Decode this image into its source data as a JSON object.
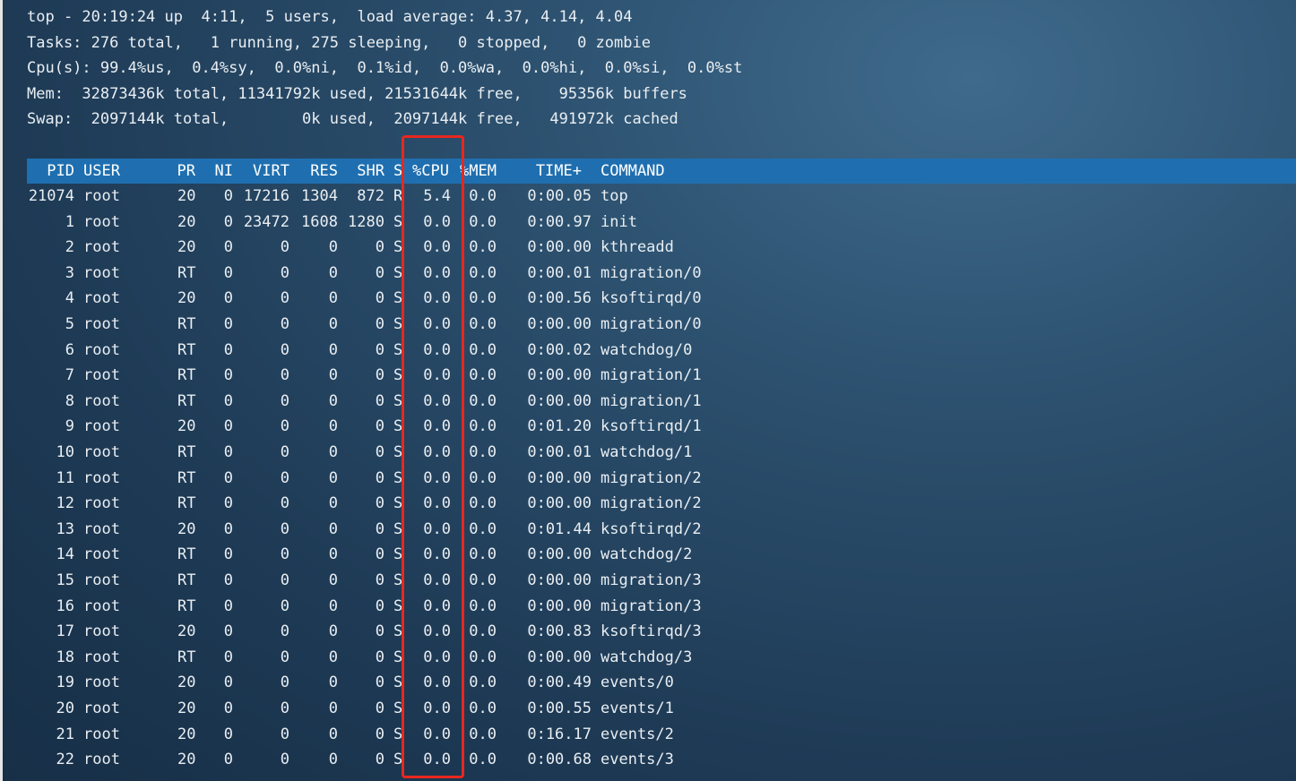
{
  "summary": {
    "line1": "top - 20:19:24 up  4:11,  5 users,  load average: 4.37, 4.14, 4.04",
    "line2": "Tasks: 276 total,   1 running, 275 sleeping,   0 stopped,   0 zombie",
    "line3": "Cpu(s): 99.4%us,  0.4%sy,  0.0%ni,  0.1%id,  0.0%wa,  0.0%hi,  0.0%si,  0.0%st",
    "line4": "Mem:  32873436k total, 11341792k used, 21531644k free,    95356k buffers",
    "line5": "Swap:  2097144k total,        0k used,  2097144k free,   491972k cached"
  },
  "columns": [
    "PID",
    "USER",
    "PR",
    "NI",
    "VIRT",
    "RES",
    "SHR",
    "S",
    "%CPU",
    "%MEM",
    "TIME+",
    "COMMAND"
  ],
  "processes": [
    {
      "pid": "21074",
      "user": "root",
      "pr": "20",
      "ni": "0",
      "virt": "17216",
      "res": "1304",
      "shr": "872",
      "s": "R",
      "cpu": "5.4",
      "mem": "0.0",
      "time": "0:00.05",
      "cmd": "top"
    },
    {
      "pid": "1",
      "user": "root",
      "pr": "20",
      "ni": "0",
      "virt": "23472",
      "res": "1608",
      "shr": "1280",
      "s": "S",
      "cpu": "0.0",
      "mem": "0.0",
      "time": "0:00.97",
      "cmd": "init"
    },
    {
      "pid": "2",
      "user": "root",
      "pr": "20",
      "ni": "0",
      "virt": "0",
      "res": "0",
      "shr": "0",
      "s": "S",
      "cpu": "0.0",
      "mem": "0.0",
      "time": "0:00.00",
      "cmd": "kthreadd"
    },
    {
      "pid": "3",
      "user": "root",
      "pr": "RT",
      "ni": "0",
      "virt": "0",
      "res": "0",
      "shr": "0",
      "s": "S",
      "cpu": "0.0",
      "mem": "0.0",
      "time": "0:00.01",
      "cmd": "migration/0"
    },
    {
      "pid": "4",
      "user": "root",
      "pr": "20",
      "ni": "0",
      "virt": "0",
      "res": "0",
      "shr": "0",
      "s": "S",
      "cpu": "0.0",
      "mem": "0.0",
      "time": "0:00.56",
      "cmd": "ksoftirqd/0"
    },
    {
      "pid": "5",
      "user": "root",
      "pr": "RT",
      "ni": "0",
      "virt": "0",
      "res": "0",
      "shr": "0",
      "s": "S",
      "cpu": "0.0",
      "mem": "0.0",
      "time": "0:00.00",
      "cmd": "migration/0"
    },
    {
      "pid": "6",
      "user": "root",
      "pr": "RT",
      "ni": "0",
      "virt": "0",
      "res": "0",
      "shr": "0",
      "s": "S",
      "cpu": "0.0",
      "mem": "0.0",
      "time": "0:00.02",
      "cmd": "watchdog/0"
    },
    {
      "pid": "7",
      "user": "root",
      "pr": "RT",
      "ni": "0",
      "virt": "0",
      "res": "0",
      "shr": "0",
      "s": "S",
      "cpu": "0.0",
      "mem": "0.0",
      "time": "0:00.00",
      "cmd": "migration/1"
    },
    {
      "pid": "8",
      "user": "root",
      "pr": "RT",
      "ni": "0",
      "virt": "0",
      "res": "0",
      "shr": "0",
      "s": "S",
      "cpu": "0.0",
      "mem": "0.0",
      "time": "0:00.00",
      "cmd": "migration/1"
    },
    {
      "pid": "9",
      "user": "root",
      "pr": "20",
      "ni": "0",
      "virt": "0",
      "res": "0",
      "shr": "0",
      "s": "S",
      "cpu": "0.0",
      "mem": "0.0",
      "time": "0:01.20",
      "cmd": "ksoftirqd/1"
    },
    {
      "pid": "10",
      "user": "root",
      "pr": "RT",
      "ni": "0",
      "virt": "0",
      "res": "0",
      "shr": "0",
      "s": "S",
      "cpu": "0.0",
      "mem": "0.0",
      "time": "0:00.01",
      "cmd": "watchdog/1"
    },
    {
      "pid": "11",
      "user": "root",
      "pr": "RT",
      "ni": "0",
      "virt": "0",
      "res": "0",
      "shr": "0",
      "s": "S",
      "cpu": "0.0",
      "mem": "0.0",
      "time": "0:00.00",
      "cmd": "migration/2"
    },
    {
      "pid": "12",
      "user": "root",
      "pr": "RT",
      "ni": "0",
      "virt": "0",
      "res": "0",
      "shr": "0",
      "s": "S",
      "cpu": "0.0",
      "mem": "0.0",
      "time": "0:00.00",
      "cmd": "migration/2"
    },
    {
      "pid": "13",
      "user": "root",
      "pr": "20",
      "ni": "0",
      "virt": "0",
      "res": "0",
      "shr": "0",
      "s": "S",
      "cpu": "0.0",
      "mem": "0.0",
      "time": "0:01.44",
      "cmd": "ksoftirqd/2"
    },
    {
      "pid": "14",
      "user": "root",
      "pr": "RT",
      "ni": "0",
      "virt": "0",
      "res": "0",
      "shr": "0",
      "s": "S",
      "cpu": "0.0",
      "mem": "0.0",
      "time": "0:00.00",
      "cmd": "watchdog/2"
    },
    {
      "pid": "15",
      "user": "root",
      "pr": "RT",
      "ni": "0",
      "virt": "0",
      "res": "0",
      "shr": "0",
      "s": "S",
      "cpu": "0.0",
      "mem": "0.0",
      "time": "0:00.00",
      "cmd": "migration/3"
    },
    {
      "pid": "16",
      "user": "root",
      "pr": "RT",
      "ni": "0",
      "virt": "0",
      "res": "0",
      "shr": "0",
      "s": "S",
      "cpu": "0.0",
      "mem": "0.0",
      "time": "0:00.00",
      "cmd": "migration/3"
    },
    {
      "pid": "17",
      "user": "root",
      "pr": "20",
      "ni": "0",
      "virt": "0",
      "res": "0",
      "shr": "0",
      "s": "S",
      "cpu": "0.0",
      "mem": "0.0",
      "time": "0:00.83",
      "cmd": "ksoftirqd/3"
    },
    {
      "pid": "18",
      "user": "root",
      "pr": "RT",
      "ni": "0",
      "virt": "0",
      "res": "0",
      "shr": "0",
      "s": "S",
      "cpu": "0.0",
      "mem": "0.0",
      "time": "0:00.00",
      "cmd": "watchdog/3"
    },
    {
      "pid": "19",
      "user": "root",
      "pr": "20",
      "ni": "0",
      "virt": "0",
      "res": "0",
      "shr": "0",
      "s": "S",
      "cpu": "0.0",
      "mem": "0.0",
      "time": "0:00.49",
      "cmd": "events/0"
    },
    {
      "pid": "20",
      "user": "root",
      "pr": "20",
      "ni": "0",
      "virt": "0",
      "res": "0",
      "shr": "0",
      "s": "S",
      "cpu": "0.0",
      "mem": "0.0",
      "time": "0:00.55",
      "cmd": "events/1"
    },
    {
      "pid": "21",
      "user": "root",
      "pr": "20",
      "ni": "0",
      "virt": "0",
      "res": "0",
      "shr": "0",
      "s": "S",
      "cpu": "0.0",
      "mem": "0.0",
      "time": "0:16.17",
      "cmd": "events/2"
    },
    {
      "pid": "22",
      "user": "root",
      "pr": "20",
      "ni": "0",
      "virt": "0",
      "res": "0",
      "shr": "0",
      "s": "S",
      "cpu": "0.0",
      "mem": "0.0",
      "time": "0:00.68",
      "cmd": "events/3"
    }
  ],
  "colors": {
    "header_bar": "#1f6fb0",
    "highlight_box": "#e8271e",
    "text": "#e9eef2"
  }
}
